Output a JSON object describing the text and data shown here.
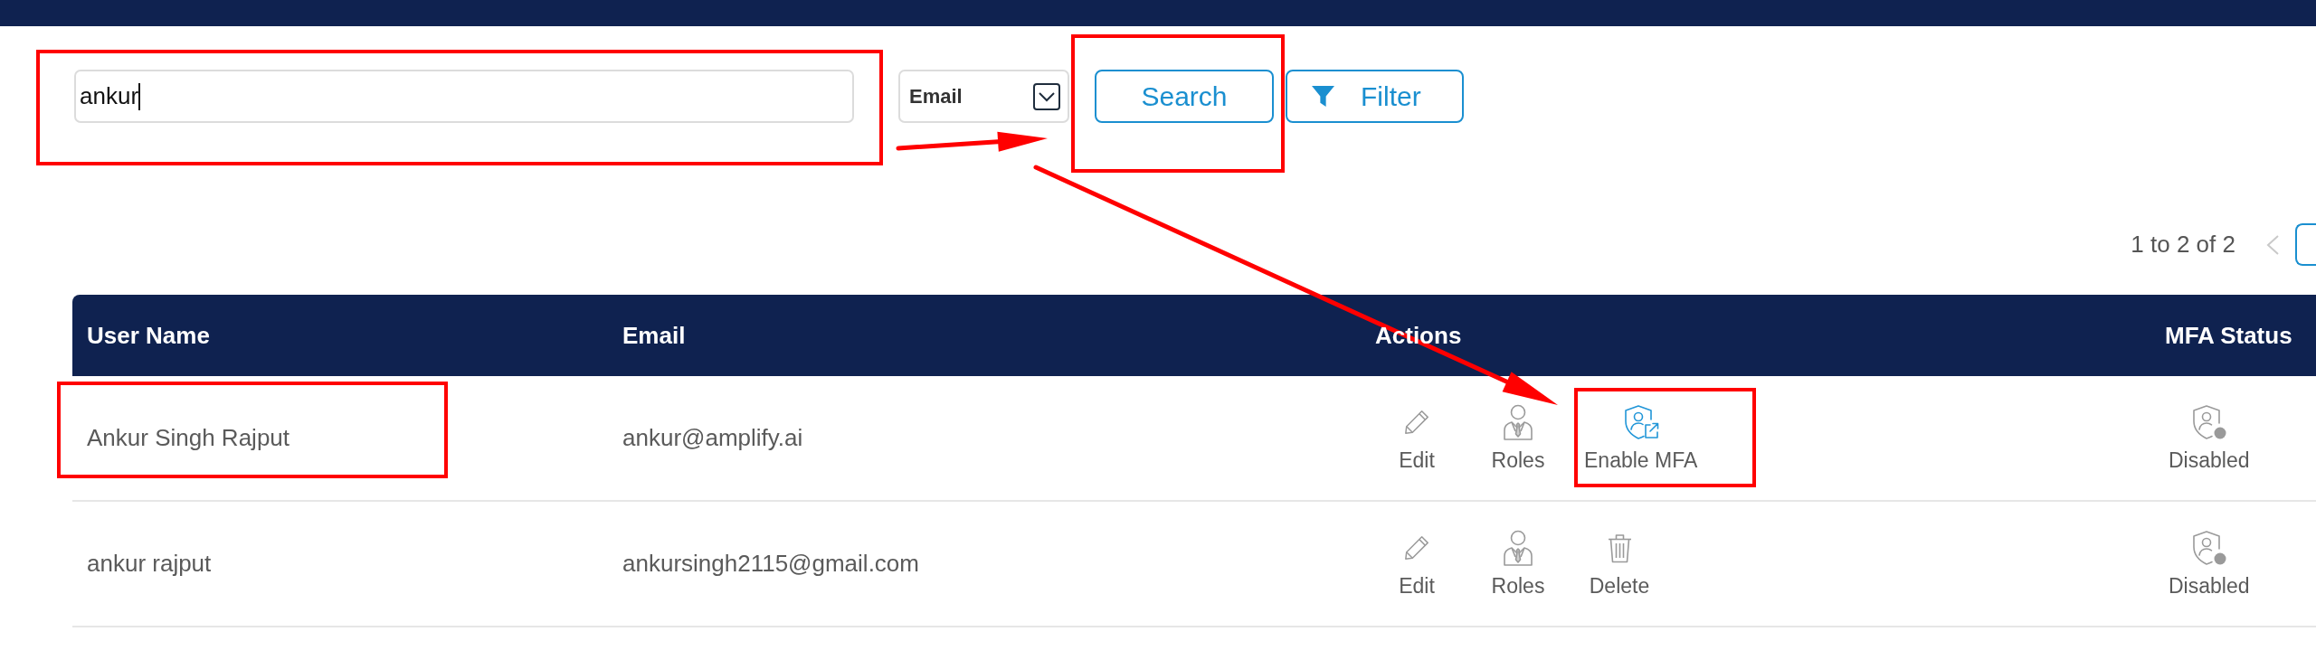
{
  "search": {
    "value": "ankur",
    "highlighted": true
  },
  "search_by": {
    "value": "Email"
  },
  "buttons": [
    {
      "kind": "search",
      "label": "Search",
      "highlighted": true
    },
    {
      "kind": "filter",
      "label": "Filter",
      "highlighted": false
    }
  ],
  "pagination": {
    "range": "1 to 2 of 2",
    "prev": {
      "disabled": true
    },
    "pages": [
      {
        "selected": true
      }
    ]
  },
  "table": {
    "columns": [
      "User Name",
      "Email",
      "Actions",
      "MFA Status"
    ],
    "rows": [
      {
        "user_name": {
          "text": "Ankur Singh Rajput",
          "highlighted": true
        },
        "email": "ankur@amplify.ai",
        "actions": [
          {
            "kind": "edit",
            "label": "Edit",
            "highlighted": false
          },
          {
            "kind": "roles",
            "label": "Roles",
            "highlighted": false
          },
          {
            "kind": "enable_mfa",
            "label": "Enable MFA",
            "highlighted": true
          }
        ],
        "mfa_status": {
          "label": "Disabled",
          "enabled": false
        }
      },
      {
        "user_name": {
          "text": "ankur rajput",
          "highlighted": false
        },
        "email": "ankursingh2115@gmail.com",
        "actions": [
          {
            "kind": "edit",
            "label": "Edit",
            "highlighted": false
          },
          {
            "kind": "roles",
            "label": "Roles",
            "highlighted": false
          },
          {
            "kind": "delete",
            "label": "Delete",
            "highlighted": false
          }
        ],
        "mfa_status": {
          "label": "Disabled",
          "enabled": false
        }
      }
    ]
  }
}
